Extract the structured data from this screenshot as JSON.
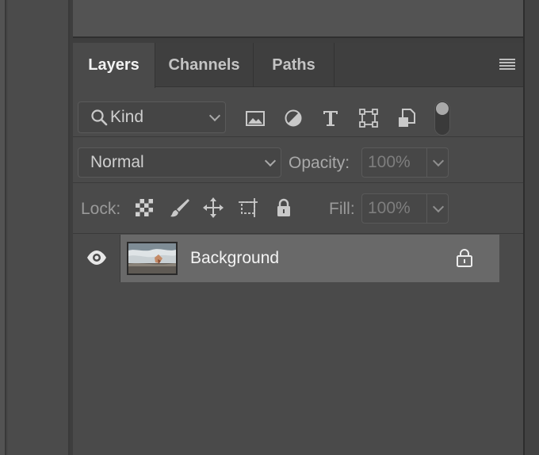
{
  "tabs": {
    "layers": "Layers",
    "channels": "Channels",
    "paths": "Paths"
  },
  "filter": {
    "kind_label": "Kind",
    "icons": [
      "pixel-filter-icon",
      "adjustment-filter-icon",
      "type-filter-icon",
      "shape-filter-icon",
      "smart-object-filter-icon"
    ],
    "toggle_on": false
  },
  "blend": {
    "mode": "Normal",
    "opacity_label": "Opacity:",
    "opacity_value": "100%"
  },
  "lock": {
    "label": "Lock:",
    "icons": [
      "lock-transparent-pixels-icon",
      "lock-image-pixels-icon",
      "lock-position-icon",
      "lock-artboard-icon",
      "lock-all-icon"
    ],
    "fill_label": "Fill:",
    "fill_value": "100%"
  },
  "layers": [
    {
      "name": "Background",
      "visible": true,
      "locked": true,
      "selected": true
    }
  ],
  "colors": {
    "panel_bg": "#4a4a4a",
    "tabbar_bg": "#3f3f3f",
    "selected_row": "#696969"
  }
}
